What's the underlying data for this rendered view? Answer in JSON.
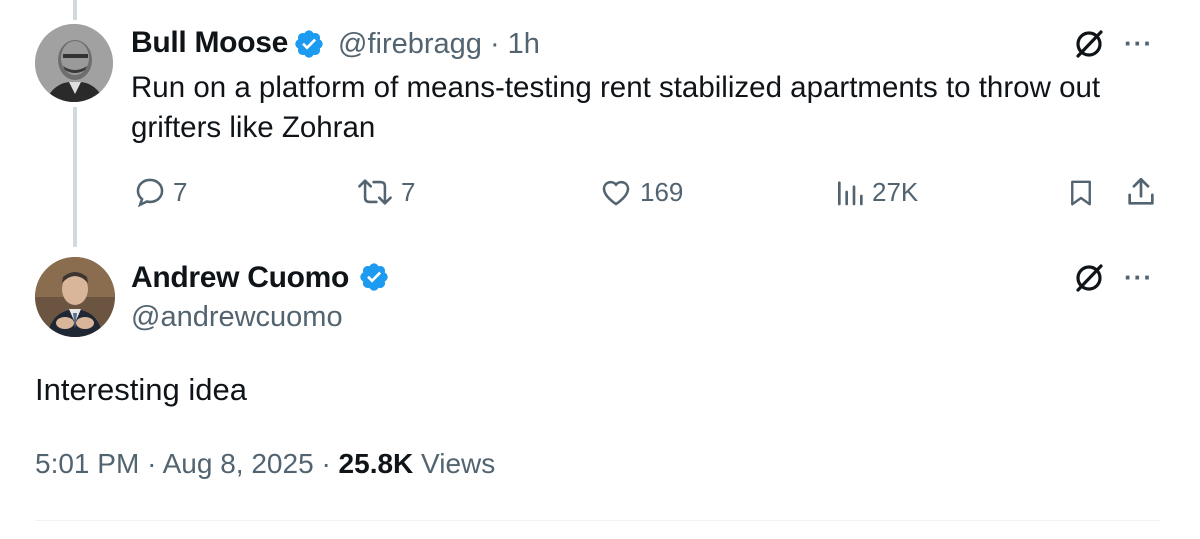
{
  "parent_tweet": {
    "display_name": "Bull Moose",
    "handle": "@firebragg",
    "time": "· 1h",
    "text": "Run on a platform of means-testing rent stabilized apartments to throw out grifters like Zohran",
    "replies": "7",
    "reposts": "7",
    "likes": "169",
    "views": "27K",
    "icons": [
      "reply-icon",
      "repost-icon",
      "like-icon",
      "views-icon",
      "bookmark-icon",
      "share-icon",
      "grok-icon",
      "more-icon",
      "verified-icon"
    ]
  },
  "main_tweet": {
    "display_name": "Andrew Cuomo",
    "handle": "@andrewcuomo",
    "text": "Interesting idea",
    "time": "5:01 PM",
    "date": "Aug 8, 2025",
    "views_count": "25.8K",
    "views_label": "Views"
  },
  "ui": {
    "more_glyph": "···",
    "separator": "·",
    "accent": "#1d9bf0",
    "muted": "#536471"
  }
}
